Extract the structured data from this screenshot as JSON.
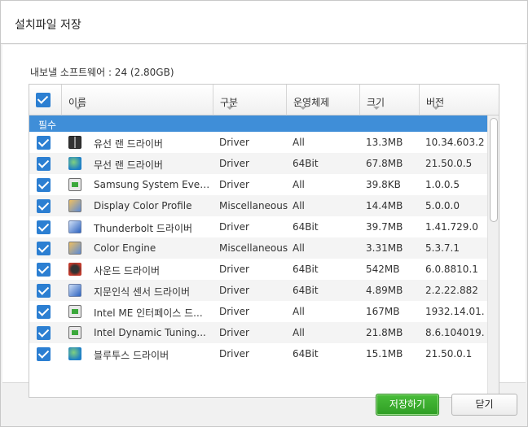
{
  "dialog": {
    "title": "설치파일 저장",
    "count_label": "내보낼 소프트웨어 : 24 (2.80GB)"
  },
  "table": {
    "columns": [
      "이름",
      "구분",
      "운영체제",
      "크기",
      "버전"
    ],
    "group_label": "필수",
    "rows": [
      {
        "icon": "network-driver-icon",
        "name": "유선 랜 드라이버",
        "type": "Driver",
        "os": "All",
        "size": "13.3MB",
        "version": "10.34.603.2..."
      },
      {
        "icon": "wireless-globe-icon",
        "name": "무선 랜 드라이버",
        "type": "Driver",
        "os": "64Bit",
        "size": "67.8MB",
        "version": "21.50.0.5"
      },
      {
        "icon": "system-board-icon",
        "name": "Samsung System Event...",
        "type": "Driver",
        "os": "All",
        "size": "39.8KB",
        "version": "1.0.0.5"
      },
      {
        "icon": "color-profile-icon",
        "name": "Display Color Profile",
        "type": "Miscellaneous",
        "os": "All",
        "size": "14.4MB",
        "version": "5.0.0.0"
      },
      {
        "icon": "thunderbolt-icon",
        "name": "Thunderbolt 드라이버",
        "type": "Driver",
        "os": "64Bit",
        "size": "39.7MB",
        "version": "1.41.729.0"
      },
      {
        "icon": "color-engine-icon",
        "name": "Color Engine",
        "type": "Miscellaneous",
        "os": "All",
        "size": "3.31MB",
        "version": "5.3.7.1"
      },
      {
        "icon": "sound-driver-icon",
        "name": "사운드 드라이버",
        "type": "Driver",
        "os": "64Bit",
        "size": "542MB",
        "version": "6.0.8810.1"
      },
      {
        "icon": "fingerprint-icon",
        "name": "지문인식 센서 드라이버",
        "type": "Driver",
        "os": "64Bit",
        "size": "4.89MB",
        "version": "2.2.22.882"
      },
      {
        "icon": "intel-me-icon",
        "name": "Intel ME 인터페이스 드...",
        "type": "Driver",
        "os": "All",
        "size": "167MB",
        "version": "1932.14.01..."
      },
      {
        "icon": "intel-tuning-icon",
        "name": "Intel Dynamic Tuning...",
        "type": "Driver",
        "os": "All",
        "size": "21.8MB",
        "version": "8.6.104019..."
      },
      {
        "icon": "bluetooth-globe-icon",
        "name": "블루투스 드라이버",
        "type": "Driver",
        "os": "64Bit",
        "size": "15.1MB",
        "version": "21.50.0.1"
      }
    ]
  },
  "buttons": {
    "save": "저장하기",
    "close": "닫기"
  }
}
